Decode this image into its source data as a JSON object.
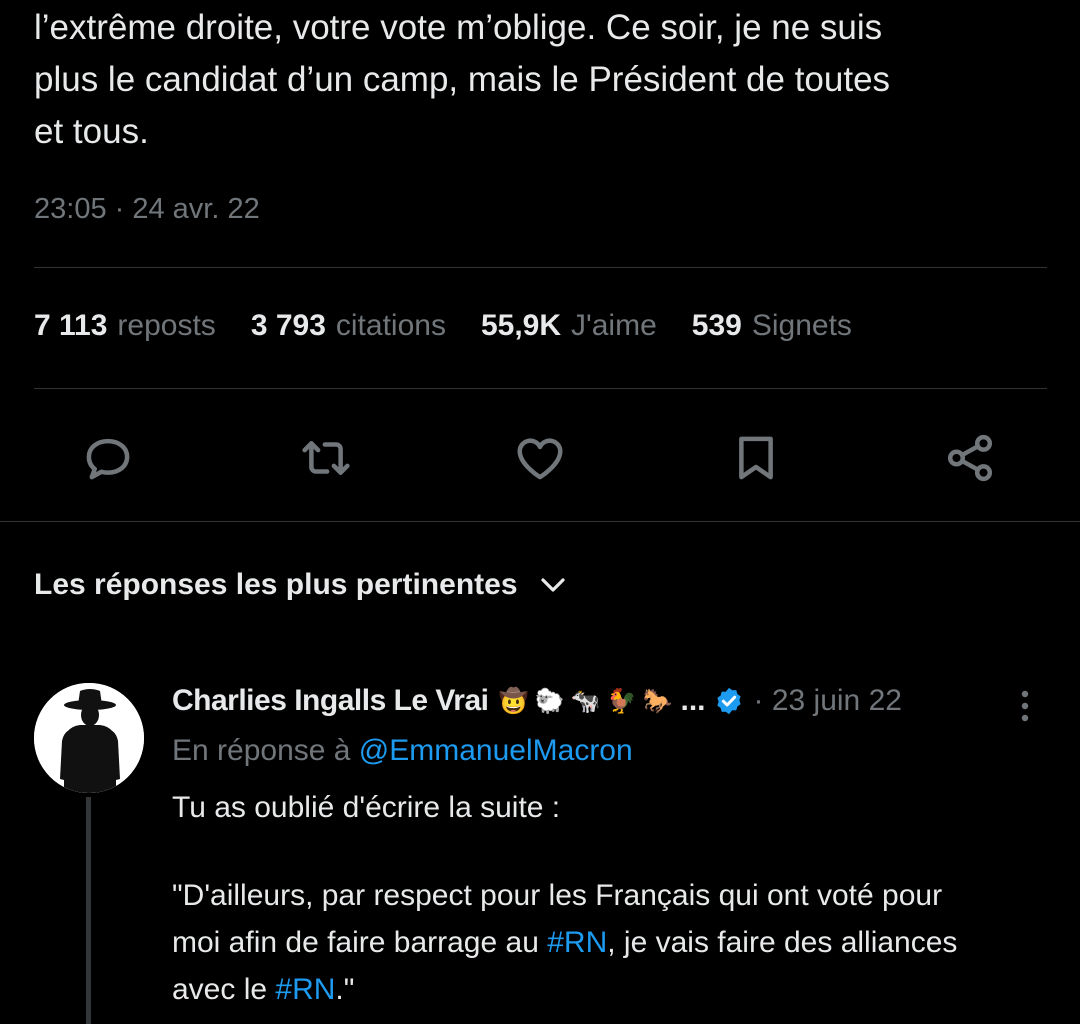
{
  "tweet": {
    "text_lines": [
      "l’extrême droite, votre vote m’oblige. Ce soir, je ne suis",
      "plus le candidat d’un camp, mais le Président de toutes",
      "et tous."
    ],
    "timestamp": "23:05 · 24 avr. 22"
  },
  "stats": [
    {
      "value": "7 113",
      "label": "reposts"
    },
    {
      "value": "3 793",
      "label": "citations"
    },
    {
      "value": "55,9K",
      "label": "J'aime"
    },
    {
      "value": "539",
      "label": "Signets"
    }
  ],
  "actions": [
    {
      "name": "reply",
      "icon": "reply-icon"
    },
    {
      "name": "repost",
      "icon": "repost-icon"
    },
    {
      "name": "like",
      "icon": "like-icon"
    },
    {
      "name": "bookmark",
      "icon": "bookmark-icon"
    },
    {
      "name": "share",
      "icon": "share-icon"
    }
  ],
  "replies_header": {
    "label": "Les réponses les plus pertinentes",
    "icon": "chevron-down-icon"
  },
  "reply": {
    "author_name": "Charlies Ingalls Le Vrai",
    "emojis": [
      "🤠",
      "🐑",
      "🐄",
      "🐓",
      "🐎"
    ],
    "ellipsis": "...",
    "date": "· 23 juin 22",
    "reply_to_prefix": "En réponse à ",
    "reply_to_handle": "@EmmanuelMacron",
    "body_line1": "Tu as oublié d'écrire la suite :",
    "body_line2": "\"D'ailleurs, par respect pour les Français qui ont voté pour",
    "body_line3_pre": "moi afin de faire barrage au ",
    "body_line3_tag": "#RN",
    "body_line3_post": ", je vais faire des alliances",
    "body_line4_pre": "avec le ",
    "body_line4_tag": "#RN",
    "body_line4_post": ".\""
  },
  "colors": {
    "background": "#000000",
    "text_primary": "#e7e9ea",
    "text_secondary": "#71767b",
    "accent": "#1d9bf0",
    "divider": "#2f3336"
  }
}
